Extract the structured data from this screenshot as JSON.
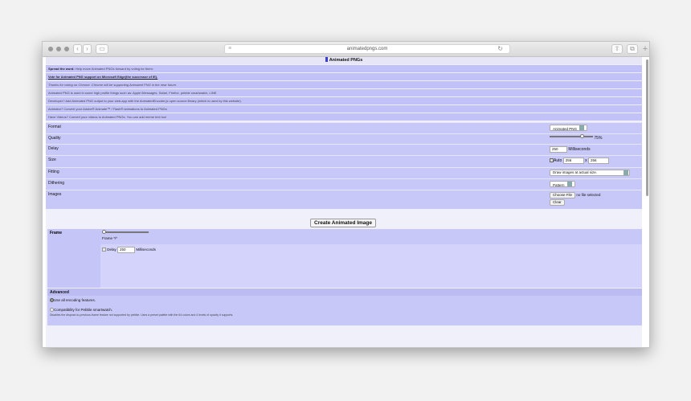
{
  "browser": {
    "url": "animatedpngs.com"
  },
  "page": {
    "title": "Animated PNGs",
    "messages": [
      {
        "lead": "Spread the word:",
        "text": " Help move Animated PNGs forward by voting for them:"
      },
      {
        "lead": "Vote for Animated PNG support on Microsoft Edge(the successor of IE).",
        "text": ""
      },
      {
        "lead": "",
        "text": "Thanks for voting on Chrome. Chrome will be supporting Animated PNG in the near future."
      },
      {
        "lead": "",
        "text": "Animated PNG is used in some high profile things such as: Apple iMessages, Safari, Firefox, pebble smartwatch, LINE"
      },
      {
        "lead": "",
        "text": "Developer? Add Animated PNG output to your web-app with the AnimatedEncoder.js open source library (which is used by this website)."
      },
      {
        "lead": "",
        "text": "Animator? Convert your Adobe® Animate™ / Flash® animations to Animated PNGs"
      },
      {
        "lead": "",
        "text": "Have Videos? Convert your videos to Animated PNGs. You can add meme text too!"
      }
    ],
    "form": {
      "format": {
        "label": "Format",
        "value": "Animated PNG"
      },
      "quality": {
        "label": "Quality",
        "value": "75%",
        "level": 0.75
      },
      "delay": {
        "label": "Delay",
        "value": "250",
        "unit": "Milliseconds"
      },
      "size": {
        "label": "Size",
        "auto_label": "Auto",
        "width": "256",
        "times": "x",
        "height": "256"
      },
      "fitting": {
        "label": "Fitting",
        "value": "Draw images at actual size."
      },
      "dithering": {
        "label": "Dithering",
        "value": "Pattern"
      },
      "images": {
        "label": "Images",
        "choose_label": "Choose File",
        "no_file": "no file selected",
        "clear_label": "Clear"
      }
    },
    "create_label": "Create Animated Image",
    "frame": {
      "label": "Frame",
      "frame_text": "Frame */*",
      "delay_label": "Delay",
      "delay_value": "250",
      "delay_unit": "Milliseconds"
    },
    "advanced": {
      "label": "Advanced",
      "opt1": "Use all encoding features.",
      "opt2": "Compatibility for Pebble smartwatch.",
      "opt2_desc": "Disables the dispose-to-previous-frame feature not supported by pebble. Uses a preset palette with the 64 colors and 4 levels of opacity it supports."
    }
  }
}
